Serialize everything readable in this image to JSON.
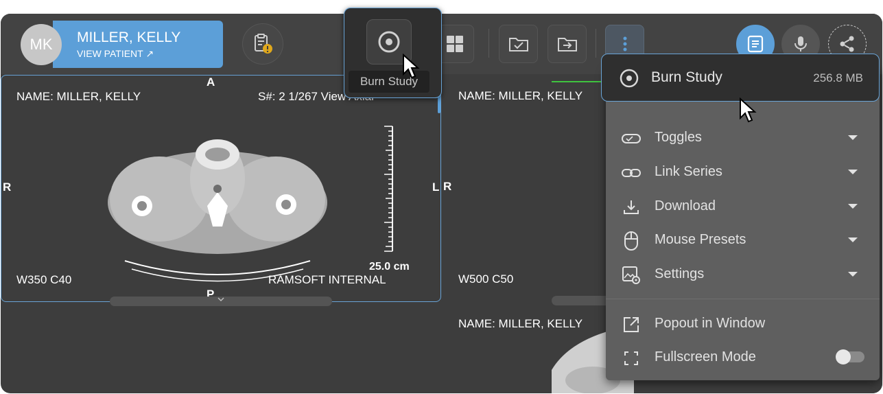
{
  "patient": {
    "initials": "MK",
    "name": "MILLER, KELLY",
    "view_patient": "VIEW PATIENT ↗"
  },
  "toolbar": {
    "burn_tooltip": "Burn Study"
  },
  "viewport_left": {
    "orient_top": "A",
    "orient_left": "R",
    "orient_right": "L",
    "orient_bottom": "P",
    "name": "NAME: MILLER, KELLY",
    "series": "S#: 2  1/267  View Axial",
    "window": "W350 C40",
    "institution": "RAMSOFT INTERNAL",
    "scale": "25.0 cm"
  },
  "viewport_right": {
    "orient_left": "R",
    "name": "NAME: MILLER, KELLY",
    "window": "W500 C50",
    "name_lower": "NAME: MILLER, KELLY"
  },
  "menu": {
    "burn_study_label": "Burn Study",
    "burn_study_size": "256.8 MB",
    "items": [
      {
        "label": "Toggles"
      },
      {
        "label": "Link Series"
      },
      {
        "label": "Download"
      },
      {
        "label": "Mouse Presets"
      },
      {
        "label": "Settings"
      }
    ],
    "popout_label": "Popout in Window",
    "fullscreen_label": "Fullscreen Mode",
    "fullscreen_on": false
  },
  "colors": {
    "accent": "#5c9fd8",
    "panel": "#3d3d3d",
    "menu_bg": "#5f5f5f"
  }
}
